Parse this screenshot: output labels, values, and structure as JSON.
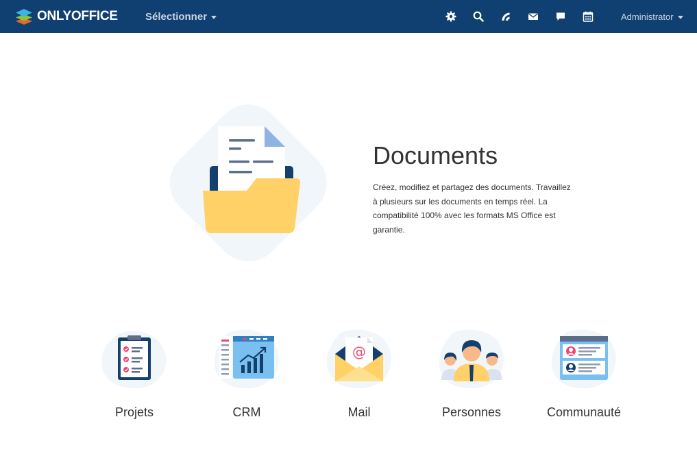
{
  "header": {
    "logo_text": "ONLYOFFICE",
    "selector_label": "Sélectionner",
    "user_label": "Administrator",
    "icons": [
      "gear-icon",
      "search-icon",
      "feed-icon",
      "mail-icon",
      "chat-icon",
      "calendar-icon"
    ]
  },
  "hero": {
    "title": "Documents",
    "description": "Créez, modifiez et partagez des documents. Travaillez à plusieurs sur les documents en temps réel. La compatibilité 100% avec les formats MS Office est garantie."
  },
  "modules": [
    {
      "label": "Projets",
      "icon": "projects-icon"
    },
    {
      "label": "CRM",
      "icon": "crm-icon"
    },
    {
      "label": "Mail",
      "icon": "mail-module-icon"
    },
    {
      "label": "Personnes",
      "icon": "people-icon"
    },
    {
      "label": "Communauté",
      "icon": "community-icon"
    }
  ],
  "colors": {
    "header_bg": "#0f4071",
    "header_text": "#c9d4e1",
    "folder_yellow": "#ffd166",
    "accent_blue": "#2f80c2",
    "accent_pink": "#f0466f"
  }
}
